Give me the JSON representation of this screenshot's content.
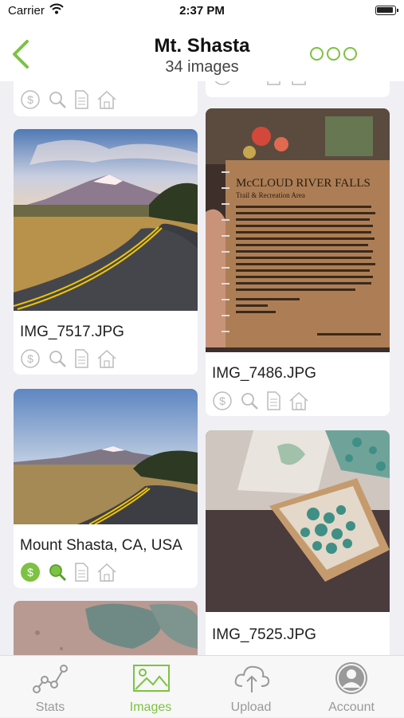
{
  "status_bar": {
    "carrier": "Carrier",
    "time": "2:37 PM"
  },
  "nav": {
    "title": "Mt. Shasta",
    "subtitle": "34 images"
  },
  "photos": {
    "img_7517": {
      "caption": "IMG_7517.JPG"
    },
    "img_7486": {
      "caption": "IMG_7486.JPG",
      "sign_title": "McCLOUD RIVER FALLS",
      "sign_subtitle": "Trail & Recreation Area"
    },
    "mount_shasta": {
      "caption": "Mount Shasta, CA, USA"
    },
    "img_7525": {
      "caption": "IMG_7525.JPG"
    }
  },
  "tabs": [
    {
      "label": "Stats"
    },
    {
      "label": "Images"
    },
    {
      "label": "Upload"
    },
    {
      "label": "Account"
    }
  ],
  "colors": {
    "accent": "#7dc242",
    "inactive": "#999999"
  }
}
